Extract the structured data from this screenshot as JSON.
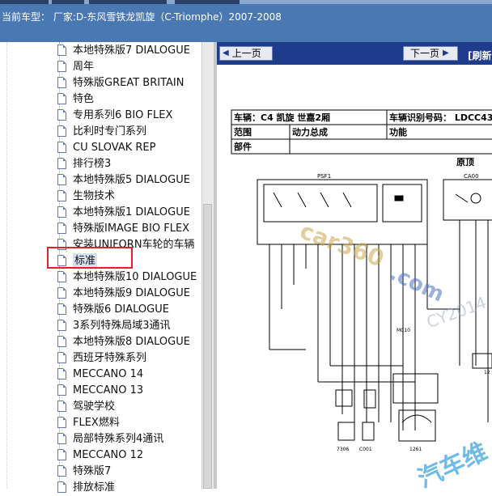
{
  "header": {
    "vehicle_line": "当前车型： 厂家:D-东风雪铁龙凯旋（C-Triomphe）2007-2008"
  },
  "tree": {
    "items": [
      {
        "label": "本地特殊版7 DIALOGUE"
      },
      {
        "label": "周年"
      },
      {
        "label": "特殊版GREAT BRITAIN"
      },
      {
        "label": "特色"
      },
      {
        "label": "专用系列6 BIO FLEX"
      },
      {
        "label": "比利时专门系列"
      },
      {
        "label": "CU SLOVAK REP"
      },
      {
        "label": "排行榜3"
      },
      {
        "label": "本地特殊版5 DIALOGUE"
      },
      {
        "label": "生物技术"
      },
      {
        "label": "本地特殊版1 DIALOGUE"
      },
      {
        "label": "特殊版IMAGE BIO FLEX"
      },
      {
        "label": "安装UNIFORN车轮的车辆"
      },
      {
        "label": "标准"
      },
      {
        "label": "本地特殊版10 DIALOGUE"
      },
      {
        "label": "本地特殊版9 DIALOGUE"
      },
      {
        "label": "特殊版6 DIALOGUE"
      },
      {
        "label": "3系列特殊局域3通讯"
      },
      {
        "label": "本地特殊版8 DIALOGUE"
      },
      {
        "label": "西班牙特殊系列"
      },
      {
        "label": "MECCANO 14"
      },
      {
        "label": "MECCANO 13"
      },
      {
        "label": "驾驶学校"
      },
      {
        "label": "FLEX燃料"
      },
      {
        "label": "局部特殊系列4通讯"
      },
      {
        "label": "MECCANO 12"
      },
      {
        "label": "特殊版7"
      },
      {
        "label": "排放标准"
      }
    ],
    "selected_index": 13
  },
  "nav": {
    "prev_label": "上一页",
    "next_label": "下一页",
    "refresh_label": "[刷新"
  },
  "doc": {
    "vehicle_label": "车辆：C4 凯旋 世嘉2厢",
    "vin_label": "车辆识别号码： LDCC43",
    "range_label": "范围",
    "powertrain_label": "动力总成",
    "function_label": "功能",
    "part_label": "部件",
    "orig_label": "原顶",
    "psf1": "PSF1",
    "ca00": "CA00",
    "c7306": "7306",
    "c001": "C001",
    "c1261": "1261",
    "mc10": "MC10",
    "w12": "12"
  },
  "watermarks": {
    "w1": "car360",
    "w2": ".com",
    "w3": "CY2014",
    "w4": "汽车维"
  },
  "colors": {
    "topbar": "#4a78b3",
    "navbar": "#1e3b8c",
    "highlight_box": "#e0202a"
  }
}
